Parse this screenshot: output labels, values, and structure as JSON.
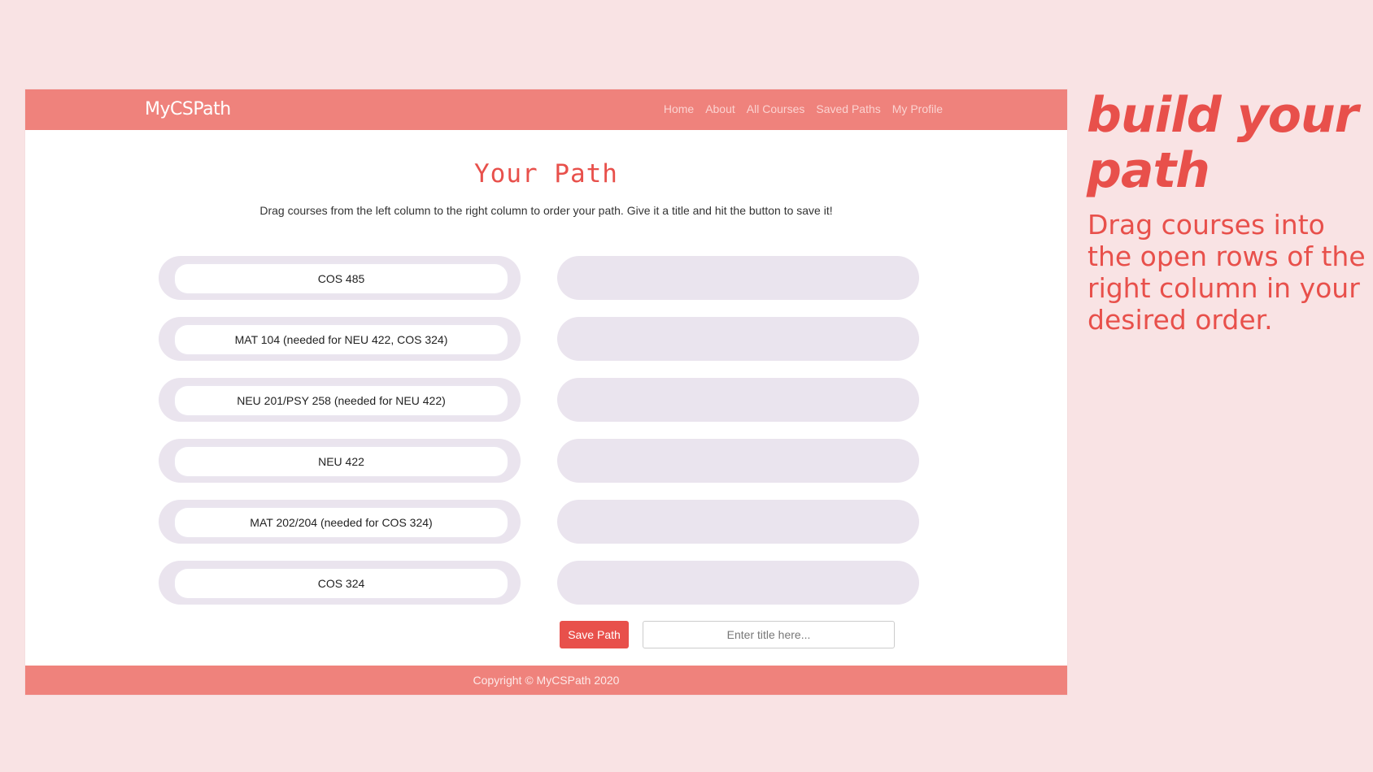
{
  "navbar": {
    "logo": "MyCSPath",
    "links": [
      "Home",
      "About",
      "All Courses",
      "Saved Paths",
      "My Profile"
    ]
  },
  "main": {
    "title": "Your Path",
    "instructions": "Drag courses from the left column to the right column to order your path. Give it a title and hit the button to save it!",
    "courses": [
      "COS 485",
      "MAT 104 (needed for NEU 422, COS 324)",
      "NEU 201/PSY 258 (needed for NEU 422)",
      "NEU 422",
      "MAT 202/204 (needed for COS 324)",
      "COS 324"
    ],
    "save_button": "Save Path",
    "title_input": {
      "value": "",
      "placeholder": "Enter title here..."
    }
  },
  "footer": {
    "text": "Copyright © MyCSPath 2020"
  },
  "sidebar": {
    "heading": "build your path",
    "body": "Drag courses into the open rows of the right column in your desired order."
  },
  "colors": {
    "accent": "#e8504b",
    "navbar": "#ef827c",
    "background": "#f9e3e4",
    "slot": "#eae4ee"
  }
}
